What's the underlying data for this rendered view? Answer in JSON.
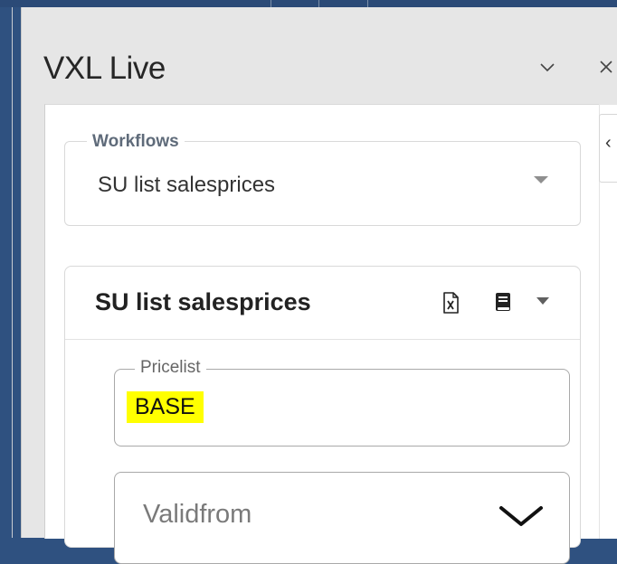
{
  "pane": {
    "title": "VXL Live",
    "chevron_icon": "chevron-down-icon",
    "close_icon": "close-icon"
  },
  "sidebar": {
    "collapse_glyph": "‹"
  },
  "workflows": {
    "label": "Workflows",
    "selected": "SU list salesprices"
  },
  "card": {
    "title": "SU list salesprices",
    "icons": [
      "excel-file-icon",
      "book-icon",
      "caret-down-icon"
    ],
    "fields": {
      "pricelist": {
        "label": "Pricelist",
        "value": "BASE",
        "highlight": "#ffff00"
      },
      "validfrom": {
        "label": "Validfrom"
      }
    }
  }
}
